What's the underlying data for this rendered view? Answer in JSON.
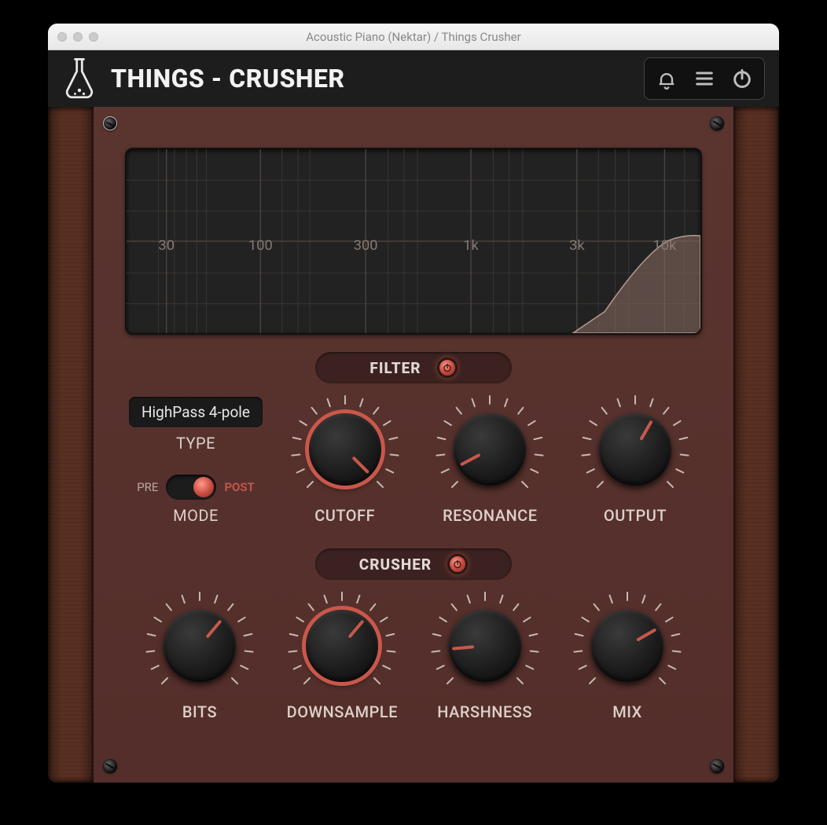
{
  "window": {
    "title": "Acoustic Piano (Nektar) / Things Crusher"
  },
  "header": {
    "title": "THINGS - CRUSHER"
  },
  "spectrum": {
    "labels": [
      "30",
      "100",
      "300",
      "1k",
      "3k",
      "10k"
    ]
  },
  "filter": {
    "section": "FILTER",
    "enabled": true,
    "type_value": "HighPass 4-pole",
    "type_label": "TYPE",
    "mode_pre": "PRE",
    "mode_post": "POST",
    "mode_label": "MODE",
    "mode_value": "post",
    "knobs": {
      "cutoff": {
        "label": "CUTOFF",
        "angle": 135,
        "accent": true
      },
      "resonance": {
        "label": "RESONANCE",
        "angle": -118,
        "accent": false
      },
      "output": {
        "label": "OUTPUT",
        "angle": 30,
        "accent": false
      }
    }
  },
  "crusher": {
    "section": "CRUSHER",
    "enabled": true,
    "knobs": {
      "bits": {
        "label": "BITS",
        "angle": 40,
        "accent": false
      },
      "downsample": {
        "label": "DOWNSAMPLE",
        "angle": 40,
        "accent": true
      },
      "harshness": {
        "label": "HARSHNESS",
        "angle": -95,
        "accent": false
      },
      "mix": {
        "label": "MIX",
        "angle": 60,
        "accent": false
      }
    }
  }
}
